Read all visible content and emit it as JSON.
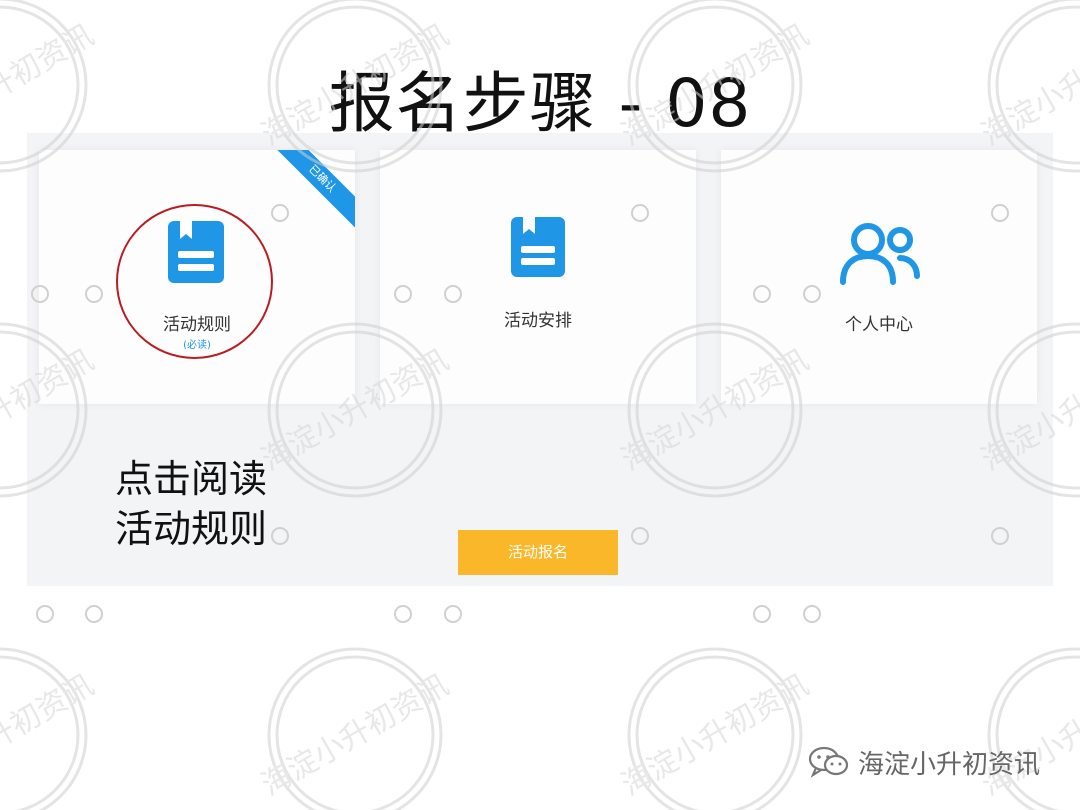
{
  "slide": {
    "title": "报名步骤 - 08"
  },
  "cards": [
    {
      "label": "活动规则",
      "sub": "(必读)",
      "badge": "已确认",
      "icon": "book-icon"
    },
    {
      "label": "活动安排",
      "icon": "book-icon"
    },
    {
      "label": "个人中心",
      "icon": "users-icon"
    }
  ],
  "instruction": {
    "line1": "点击阅读",
    "line2": "活动规则"
  },
  "register_button": {
    "label": "活动报名"
  },
  "footer": {
    "account": "海淀小升初资讯",
    "icon": "wechat-icon"
  },
  "watermark": {
    "text": "海淀小升初资讯"
  },
  "colors": {
    "accent": "#1f96e6",
    "button": "#fbb72a",
    "highlight": "#b81c22"
  }
}
